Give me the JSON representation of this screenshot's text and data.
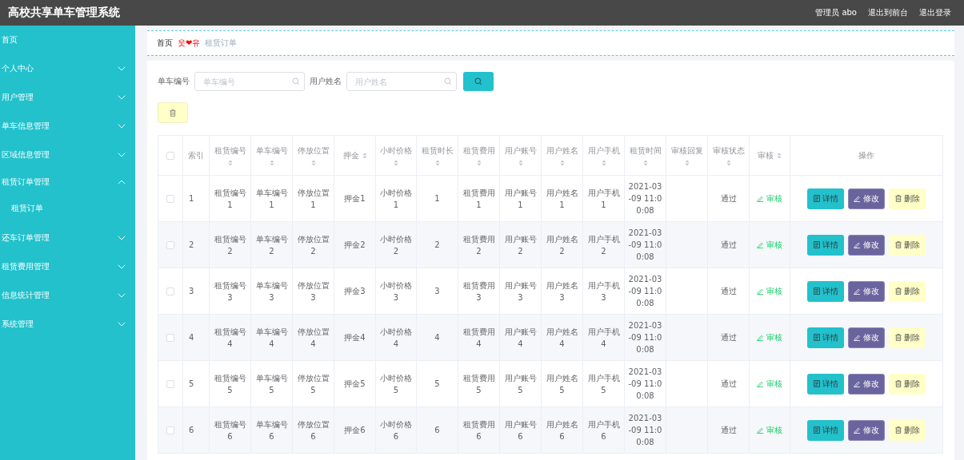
{
  "header": {
    "title": "高校共享单车管理系统",
    "user": "管理员 abo",
    "links": [
      "退出到前台",
      "退出登录"
    ]
  },
  "sidebar": {
    "items": [
      {
        "kind": "link",
        "label": "首页"
      },
      {
        "kind": "menu",
        "label": "个人中心",
        "expanded": false
      },
      {
        "kind": "menu",
        "label": "用户管理",
        "expanded": false
      },
      {
        "kind": "menu",
        "label": "单车信息管理",
        "expanded": false
      },
      {
        "kind": "menu",
        "label": "区域信息管理",
        "expanded": false
      },
      {
        "kind": "menu",
        "label": "租赁订单管理",
        "expanded": true,
        "children": [
          {
            "label": "租赁订单"
          }
        ]
      },
      {
        "kind": "menu",
        "label": "还车订单管理",
        "expanded": false
      },
      {
        "kind": "menu",
        "label": "租赁费用管理",
        "expanded": false
      },
      {
        "kind": "menu",
        "label": "信息统计管理",
        "expanded": false
      },
      {
        "kind": "menu",
        "label": "系统管理",
        "expanded": false
      }
    ]
  },
  "breadcrumb": {
    "home": "首页",
    "separator": "웃❤유",
    "current": "租赁订单"
  },
  "search": {
    "fields": [
      {
        "label": "单车编号",
        "placeholder": "单车编号"
      },
      {
        "label": "用户姓名",
        "placeholder": "用户姓名"
      }
    ]
  },
  "table": {
    "select_all": false,
    "columns": [
      {
        "kind": "plain",
        "label": "索引"
      },
      {
        "kind": "sortable",
        "label": "租赁编号"
      },
      {
        "kind": "sortable",
        "label": "单车编号"
      },
      {
        "kind": "sortable",
        "label": "停放位置"
      },
      {
        "kind": "sortable_inline",
        "label": "押金"
      },
      {
        "kind": "sortable",
        "label": "小时价格"
      },
      {
        "kind": "sortable",
        "label": "租赁时长"
      },
      {
        "kind": "sortable",
        "label": "租赁费用"
      },
      {
        "kind": "sortable",
        "label": "用户账号"
      },
      {
        "kind": "sortable",
        "label": "用户姓名"
      },
      {
        "kind": "sortable",
        "label": "用户手机"
      },
      {
        "kind": "sortable",
        "label": "租赁时间"
      },
      {
        "kind": "sortable",
        "label": "审核回复"
      },
      {
        "kind": "sortable",
        "label": "审核状态"
      },
      {
        "kind": "sortable_inline",
        "label": "审核"
      },
      {
        "kind": "plain",
        "label": "操作"
      }
    ],
    "rows": [
      {
        "selected": false,
        "cells": [
          "1",
          "租赁编号1",
          "单车编号1",
          "停放位置1",
          "押金1",
          "小时价格1",
          "1",
          "租赁费用1",
          "用户账号1",
          "用户姓名1",
          "用户手机1",
          "2021-03-09 11:00:08",
          "",
          "通过"
        ],
        "audit": "审核",
        "actions": [
          {
            "kind": "detail",
            "label": "详情"
          },
          {
            "kind": "edit",
            "label": "修改"
          },
          {
            "kind": "delete",
            "label": "删除"
          }
        ]
      },
      {
        "selected": false,
        "cells": [
          "2",
          "租赁编号2",
          "单车编号2",
          "停放位置2",
          "押金2",
          "小时价格2",
          "2",
          "租赁费用2",
          "用户账号2",
          "用户姓名2",
          "用户手机2",
          "2021-03-09 11:00:08",
          "",
          "通过"
        ],
        "audit": "审核",
        "actions": [
          {
            "kind": "detail",
            "label": "详情"
          },
          {
            "kind": "edit",
            "label": "修改"
          },
          {
            "kind": "delete",
            "label": "删除"
          }
        ]
      },
      {
        "selected": false,
        "cells": [
          "3",
          "租赁编号3",
          "单车编号3",
          "停放位置3",
          "押金3",
          "小时价格3",
          "3",
          "租赁费用3",
          "用户账号3",
          "用户姓名3",
          "用户手机3",
          "2021-03-09 11:00:08",
          "",
          "通过"
        ],
        "audit": "审核",
        "actions": [
          {
            "kind": "detail",
            "label": "详情"
          },
          {
            "kind": "edit",
            "label": "修改"
          },
          {
            "kind": "delete",
            "label": "删除"
          }
        ]
      },
      {
        "selected": false,
        "cells": [
          "4",
          "租赁编号4",
          "单车编号4",
          "停放位置4",
          "押金4",
          "小时价格4",
          "4",
          "租赁费用4",
          "用户账号4",
          "用户姓名4",
          "用户手机4",
          "2021-03-09 11:00:08",
          "",
          "通过"
        ],
        "audit": "审核",
        "actions": [
          {
            "kind": "detail",
            "label": "详情"
          },
          {
            "kind": "edit",
            "label": "修改"
          },
          {
            "kind": "delete",
            "label": "删除"
          }
        ]
      },
      {
        "selected": false,
        "cells": [
          "5",
          "租赁编号5",
          "单车编号5",
          "停放位置5",
          "押金5",
          "小时价格5",
          "5",
          "租赁费用5",
          "用户账号5",
          "用户姓名5",
          "用户手机5",
          "2021-03-09 11:00:08",
          "",
          "通过"
        ],
        "audit": "审核",
        "actions": [
          {
            "kind": "detail",
            "label": "详情"
          },
          {
            "kind": "edit",
            "label": "修改"
          },
          {
            "kind": "delete",
            "label": "删除"
          }
        ]
      },
      {
        "selected": false,
        "cells": [
          "6",
          "租赁编号6",
          "单车编号6",
          "停放位置6",
          "押金6",
          "小时价格6",
          "6",
          "租赁费用6",
          "用户账号6",
          "用户姓名6",
          "用户手机6",
          "2021-03-09 11:00:08",
          "",
          "通过"
        ],
        "audit": "审核",
        "actions": [
          {
            "kind": "detail",
            "label": "详情"
          },
          {
            "kind": "edit",
            "label": "修改"
          },
          {
            "kind": "delete",
            "label": "删除"
          }
        ]
      }
    ]
  }
}
